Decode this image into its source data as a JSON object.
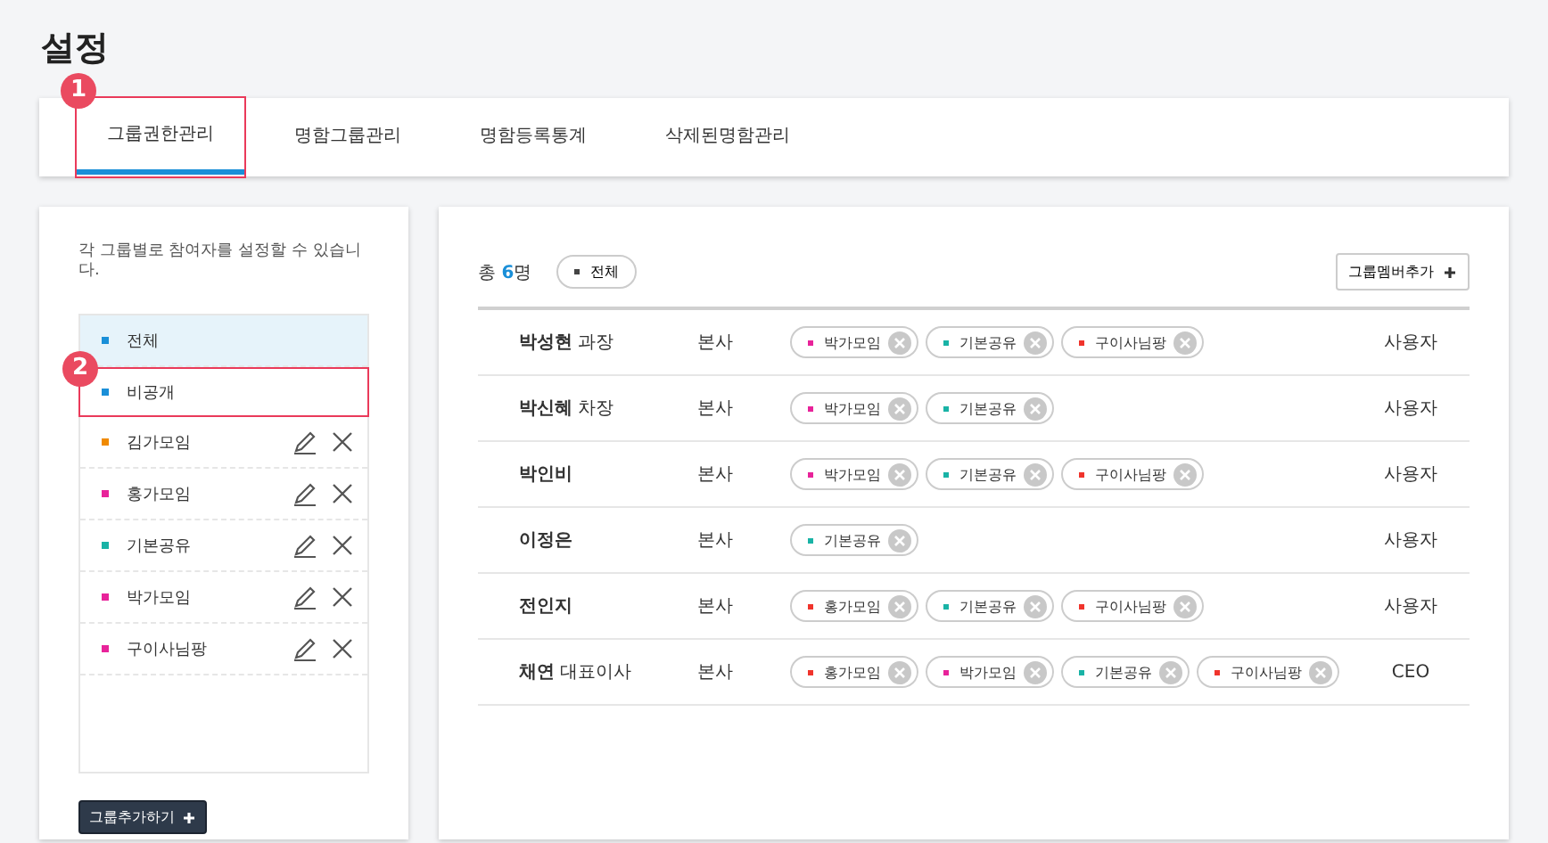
{
  "page_title": "설정",
  "tabs": [
    {
      "label": "그룹권한관리",
      "selected": true,
      "callout": "1"
    },
    {
      "label": "명함그룹관리",
      "selected": false
    },
    {
      "label": "명함등록통계",
      "selected": false
    },
    {
      "label": "삭제된명함관리",
      "selected": false
    }
  ],
  "groups_panel": {
    "description": "각 그룹별로 참여자를 설정할 수 있습니다.",
    "groups": [
      {
        "label": "전체",
        "color": "#1a8fd8",
        "selected": true,
        "editable": false
      },
      {
        "label": "비공개",
        "color": "#1a8fd8",
        "selected": false,
        "editable": false,
        "callout": "2"
      },
      {
        "label": "김가모임",
        "color": "#f08a00",
        "selected": false,
        "editable": true
      },
      {
        "label": "홍가모임",
        "color": "#e8239a",
        "selected": false,
        "editable": true
      },
      {
        "label": "기본공유",
        "color": "#19b3a6",
        "selected": false,
        "editable": true
      },
      {
        "label": "박가모임",
        "color": "#e8239a",
        "selected": false,
        "editable": true
      },
      {
        "label": "구이사님팡",
        "color": "#e8239a",
        "selected": false,
        "editable": true
      }
    ],
    "add_button": "그룹추가하기"
  },
  "members_panel": {
    "total": "총 **6**명",
    "filter": "전체",
    "add_button": "그룹멤버추가",
    "members": [
      {
        "name": "**박성현** 과장",
        "office": "본사",
        "tags": [
          {
            "label": "박가모임",
            "color": "#e8239a"
          },
          {
            "label": "기본공유",
            "color": "#19b3a6"
          },
          {
            "label": "구이사님팡",
            "color": "#f0342c"
          }
        ],
        "role": "사용자"
      },
      {
        "name": "**박신혜** 차장",
        "office": "본사",
        "tags": [
          {
            "label": "박가모임",
            "color": "#e8239a"
          },
          {
            "label": "기본공유",
            "color": "#19b3a6"
          }
        ],
        "role": "사용자"
      },
      {
        "name": "**박인비**",
        "office": "본사",
        "tags": [
          {
            "label": "박가모임",
            "color": "#e8239a"
          },
          {
            "label": "기본공유",
            "color": "#19b3a6"
          },
          {
            "label": "구이사님팡",
            "color": "#f0342c"
          }
        ],
        "role": "사용자"
      },
      {
        "name": "**이정은**",
        "office": "본사",
        "tags": [
          {
            "label": "기본공유",
            "color": "#19b3a6"
          }
        ],
        "role": "사용자"
      },
      {
        "name": "**전인지**",
        "office": "본사",
        "tags": [
          {
            "label": "홍가모임",
            "color": "#f0342c"
          },
          {
            "label": "기본공유",
            "color": "#19b3a6"
          },
          {
            "label": "구이사님팡",
            "color": "#f0342c"
          }
        ],
        "role": "사용자"
      },
      {
        "name": "**채연** 대표이사",
        "office": "본사",
        "tags": [
          {
            "label": "홍가모임",
            "color": "#f0342c"
          },
          {
            "label": "박가모임",
            "color": "#e8239a"
          },
          {
            "label": "기본공유",
            "color": "#19b3a6"
          },
          {
            "label": "구이사님팡",
            "color": "#f0342c"
          }
        ],
        "role": "CEO"
      }
    ]
  }
}
